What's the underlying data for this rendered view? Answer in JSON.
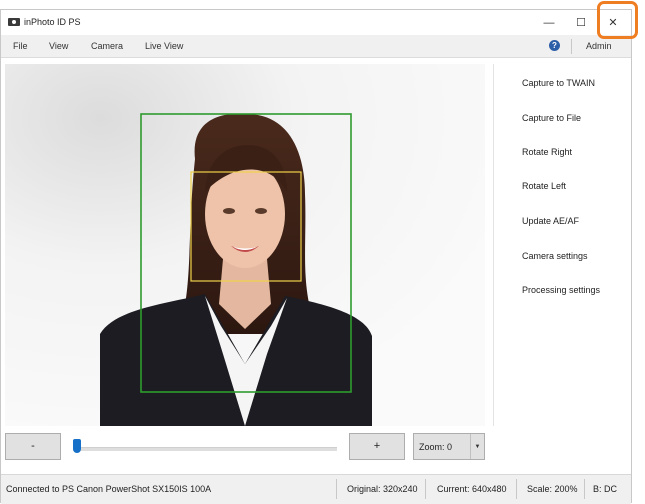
{
  "window": {
    "title": "inPhoto ID PS",
    "icon": "camera-icon"
  },
  "title_controls": {
    "minimize": "—",
    "maximize": "☐",
    "close": "✕"
  },
  "menu": {
    "items": [
      "File",
      "View",
      "Camera",
      "Live View"
    ],
    "help_symbol": "?",
    "admin": "Admin"
  },
  "actions": [
    "Capture to TWAIN",
    "Capture to File",
    "Rotate Right",
    "Rotate Left",
    "Update AE/AF",
    "Camera settings",
    "Processing settings"
  ],
  "controls": {
    "minus": "-",
    "plus": "+",
    "zoom": "Zoom: 0",
    "slider_value": 0
  },
  "status": {
    "connection": "Connected to PS Canon PowerShot SX150IS 100A",
    "original": "Original: 320x240",
    "current": "Current: 640x480",
    "scale": "Scale: 200%",
    "b": "B: DC"
  },
  "colors": {
    "face_box": "#f0d24a",
    "crop_box": "#2e9b2e",
    "highlight": "#ef7d22",
    "accent": "#1670c7"
  }
}
